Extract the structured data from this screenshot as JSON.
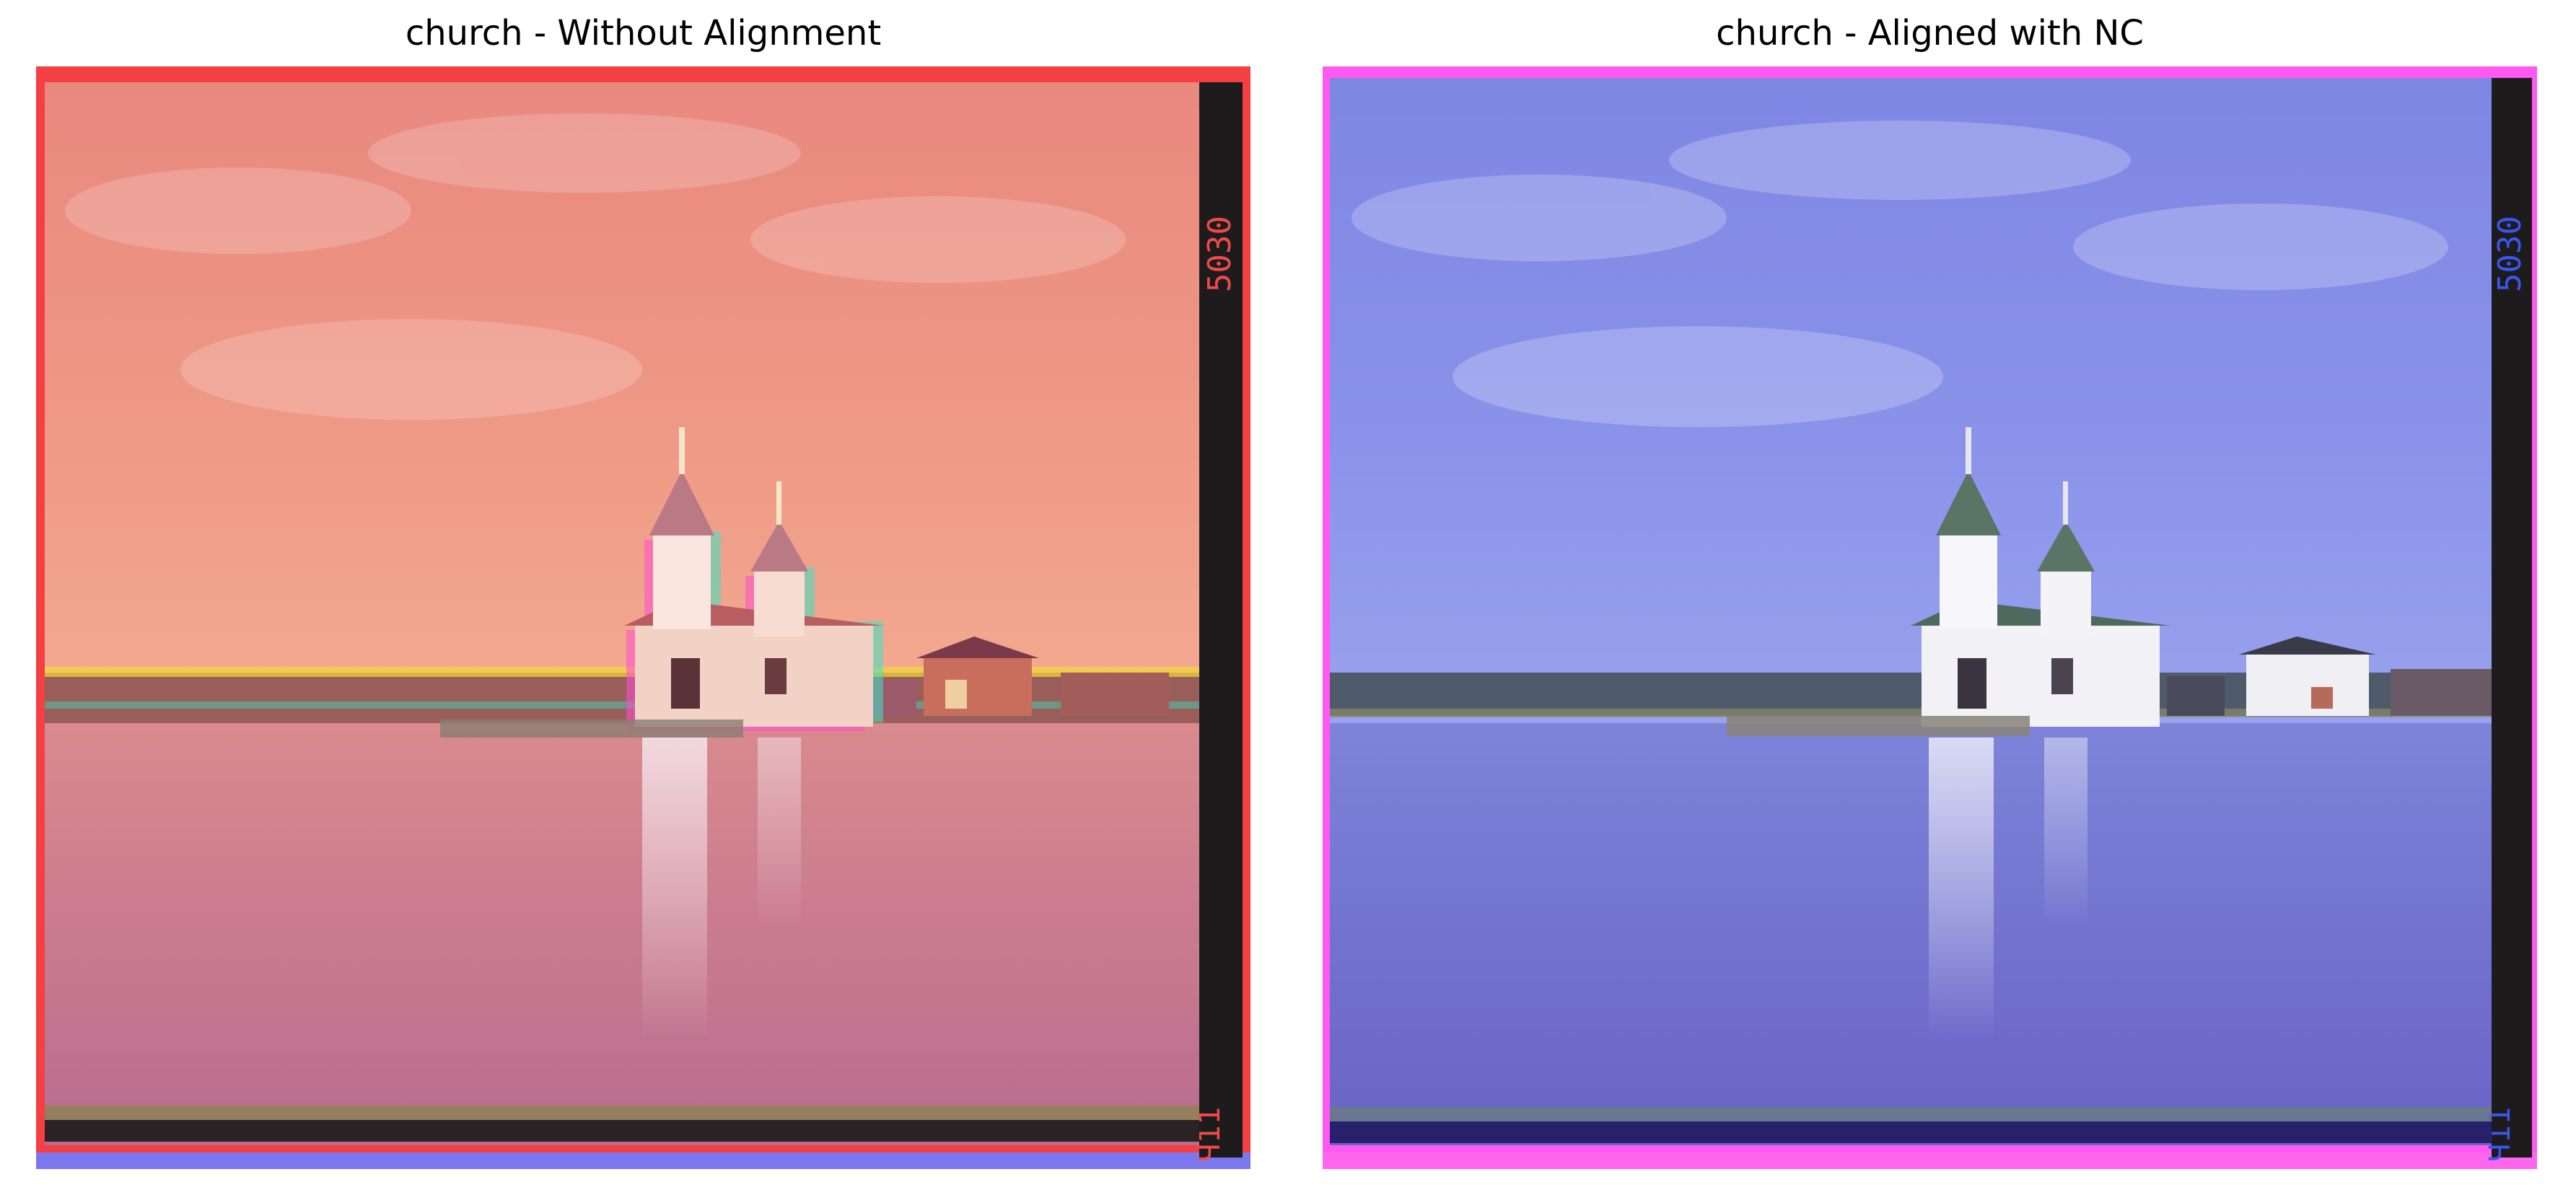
{
  "panels": [
    {
      "title": "church - Without Alignment",
      "plate_number": "5030",
      "corner_mark": "Ч11",
      "tint": "misaligned-red",
      "palette": {
        "sky_top": "#e9887f",
        "sky_mid": "#ef9a86",
        "sky_low": "#f4ad93",
        "water_top": "#d98a8e",
        "water_bottom": "#b86c8f",
        "frame": "#f43f43",
        "right_strip": "#1e1b1c",
        "bottom_bar": "#2a2224",
        "under_edge": "#7b78ef"
      }
    },
    {
      "title": "church - Aligned with NC",
      "plate_number": "5030",
      "corner_mark": "Ч11",
      "tint": "aligned-blue",
      "palette": {
        "sky_top": "#7e86e4",
        "sky_mid": "#8a93e9",
        "sky_low": "#9aa4ee",
        "water_top": "#7c84d8",
        "water_bottom": "#6a62c6",
        "frame": "#ff59f1",
        "right_strip": "#1e1b1c",
        "bottom_bar": "#27206a",
        "under_edge": "#ff66ee"
      }
    }
  ]
}
